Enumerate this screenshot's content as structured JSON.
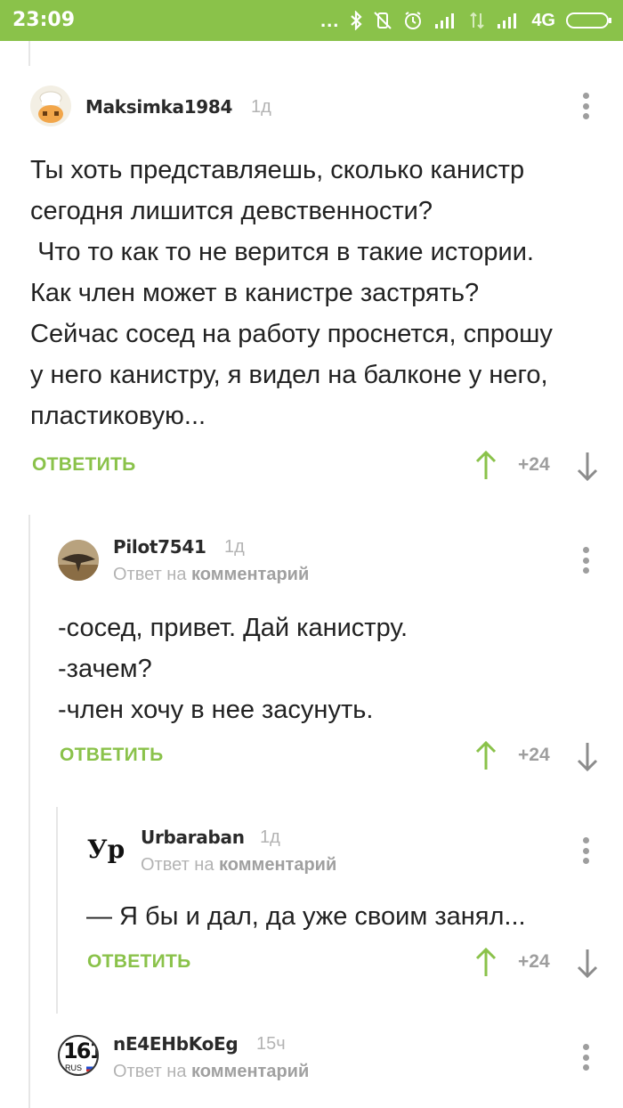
{
  "status_bar": {
    "time": "23:09",
    "network_label": "4G",
    "more_label": "..."
  },
  "comments": [
    {
      "author": "Maksimka1984",
      "time": "1д",
      "text": "Ты хоть представляешь, сколько канистр\nсегодня лишится девственности?\n Что то как то не верится в такие истории.\nКак член может в канистре застрять?\nСейчас сосед на работу проснется, спрошу\nу него канистру, я видел на балконе у него,\nпластиковую...",
      "reply_label": "ОТВЕТИТЬ",
      "rating": "+24"
    },
    {
      "author": "Pilot7541",
      "time": "1д",
      "reply_prefix": "Ответ на",
      "reply_target": "комментарий",
      "text": "-сосед, привет. Дай канистру.\n-зачем?\n-член хочу в нее засунуть.",
      "reply_label": "ОТВЕТИТЬ",
      "rating": "+24"
    },
    {
      "author": "Urbaraban",
      "avatar_text": "Ур",
      "time": "1д",
      "reply_prefix": "Ответ на",
      "reply_target": "комментарий",
      "text": "— Я бы и дал, да уже своим занял...",
      "reply_label": "ОТВЕТИТЬ",
      "rating": "+24"
    },
    {
      "author": "nE4EHbKoEg",
      "avatar_text": "161",
      "avatar_subtext": "RUS",
      "time": "15ч",
      "reply_prefix": "Ответ на",
      "reply_target": "комментарий"
    }
  ],
  "colors": {
    "accent": "#8ac24a",
    "muted": "#b3b3b3"
  }
}
